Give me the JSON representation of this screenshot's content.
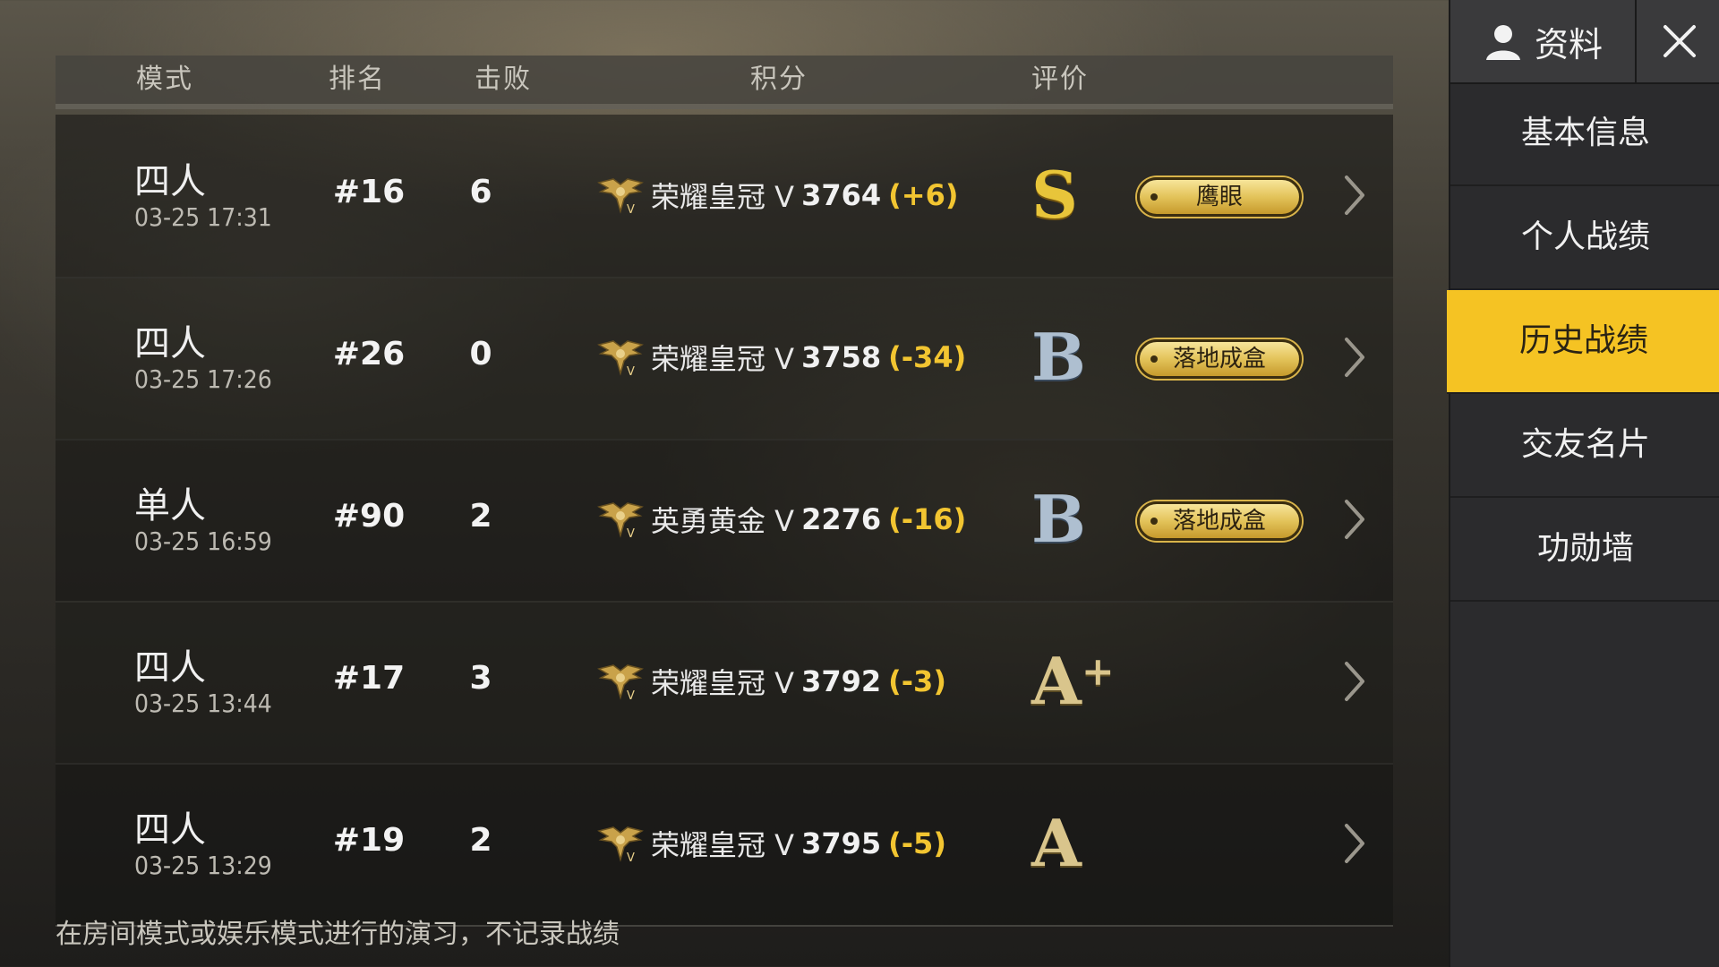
{
  "table": {
    "headers": {
      "mode": "模式",
      "rank": "排名",
      "kills": "击败",
      "score": "积分",
      "rating": "评价"
    },
    "rows": [
      {
        "mode": "四人",
        "time": "03-25 17:31",
        "rank": "#16",
        "kills": "6",
        "tier": "荣耀皇冠 V",
        "score": "3764",
        "delta": "(+6)",
        "grade": "S",
        "grade_plus": "",
        "badge": "鹰眼"
      },
      {
        "mode": "四人",
        "time": "03-25 17:26",
        "rank": "#26",
        "kills": "0",
        "tier": "荣耀皇冠 V",
        "score": "3758",
        "delta": "(-34)",
        "grade": "B",
        "grade_plus": "",
        "badge": "落地成盒"
      },
      {
        "mode": "单人",
        "time": "03-25 16:59",
        "rank": "#90",
        "kills": "2",
        "tier": "英勇黄金 V",
        "score": "2276",
        "delta": "(-16)",
        "grade": "B",
        "grade_plus": "",
        "badge": "落地成盒"
      },
      {
        "mode": "四人",
        "time": "03-25 13:44",
        "rank": "#17",
        "kills": "3",
        "tier": "荣耀皇冠 V",
        "score": "3792",
        "delta": "(-3)",
        "grade": "A",
        "grade_plus": "+",
        "badge": ""
      },
      {
        "mode": "四人",
        "time": "03-25 13:29",
        "rank": "#19",
        "kills": "2",
        "tier": "荣耀皇冠 V",
        "score": "3795",
        "delta": "(-5)",
        "grade": "A",
        "grade_plus": "",
        "badge": ""
      }
    ],
    "footer_note": "在房间模式或娱乐模式进行的演习，不记录战绩"
  },
  "panel": {
    "profile_label": "资料",
    "menu": [
      {
        "label": "基本信息",
        "active": false
      },
      {
        "label": "个人战绩",
        "active": false
      },
      {
        "label": "历史战绩",
        "active": true
      },
      {
        "label": "交友名片",
        "active": false
      },
      {
        "label": "功勋墙",
        "active": false
      }
    ]
  },
  "colors": {
    "accent": "#f5c323",
    "delta": "#f2c531",
    "panel_bg": "#2b2b2d"
  },
  "icons": [
    "user-icon",
    "close-icon",
    "wings-tier-icon",
    "chevron-right-icon"
  ]
}
